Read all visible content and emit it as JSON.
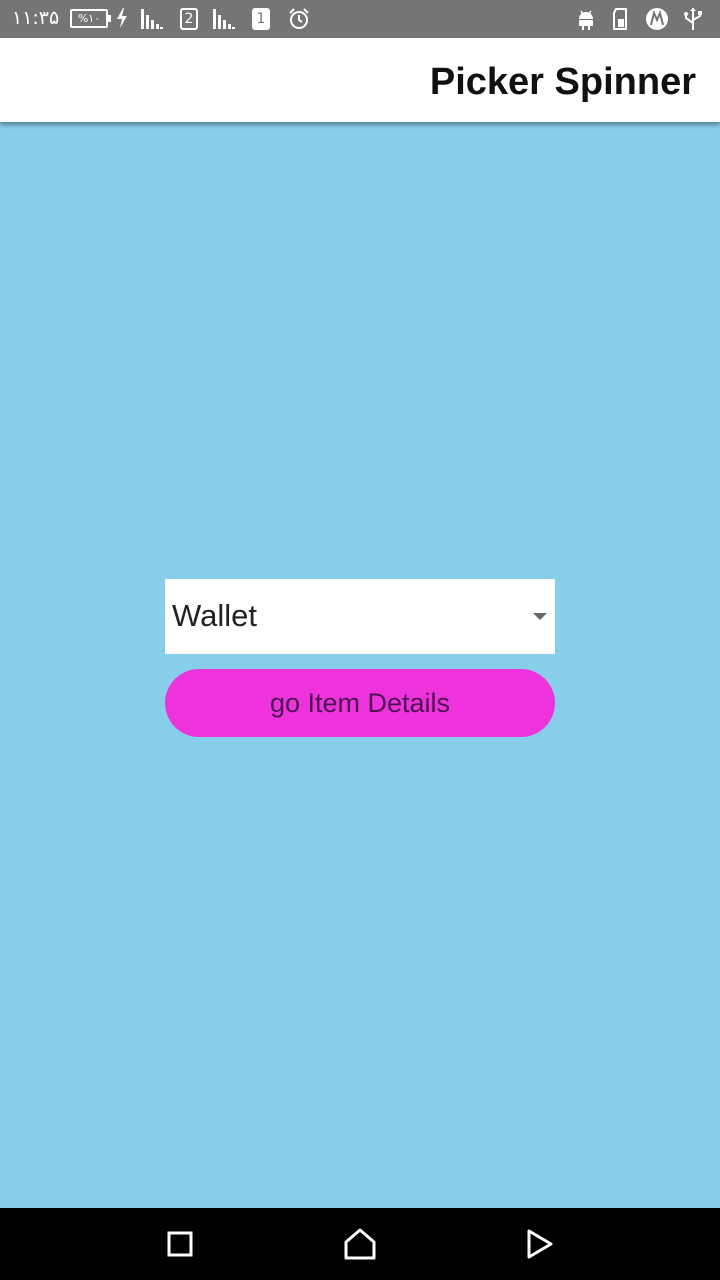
{
  "status_bar": {
    "time": "۱۱:۳۵",
    "battery_label": "%۱۰",
    "sim2_label": "2",
    "sim1_label": "1",
    "icons": [
      "bolt-icon",
      "signal-icon",
      "sim-2-icon",
      "signal-icon",
      "sim-1-icon",
      "alarm-icon",
      "android-icon",
      "sd-card-icon",
      "navigation-icon",
      "usb-icon"
    ]
  },
  "app_bar": {
    "title": "Picker Spinner"
  },
  "picker": {
    "selected": "Wallet"
  },
  "button": {
    "label": "go Item Details"
  },
  "nav_bar": {
    "icons": [
      "recents-square-icon",
      "home-icon",
      "back-play-icon"
    ]
  },
  "colors": {
    "status_bar": "#757575",
    "app_bar": "#FFFFFF",
    "background": "#87CEEB",
    "button": "#EE33DD",
    "nav_bar": "#000000"
  }
}
